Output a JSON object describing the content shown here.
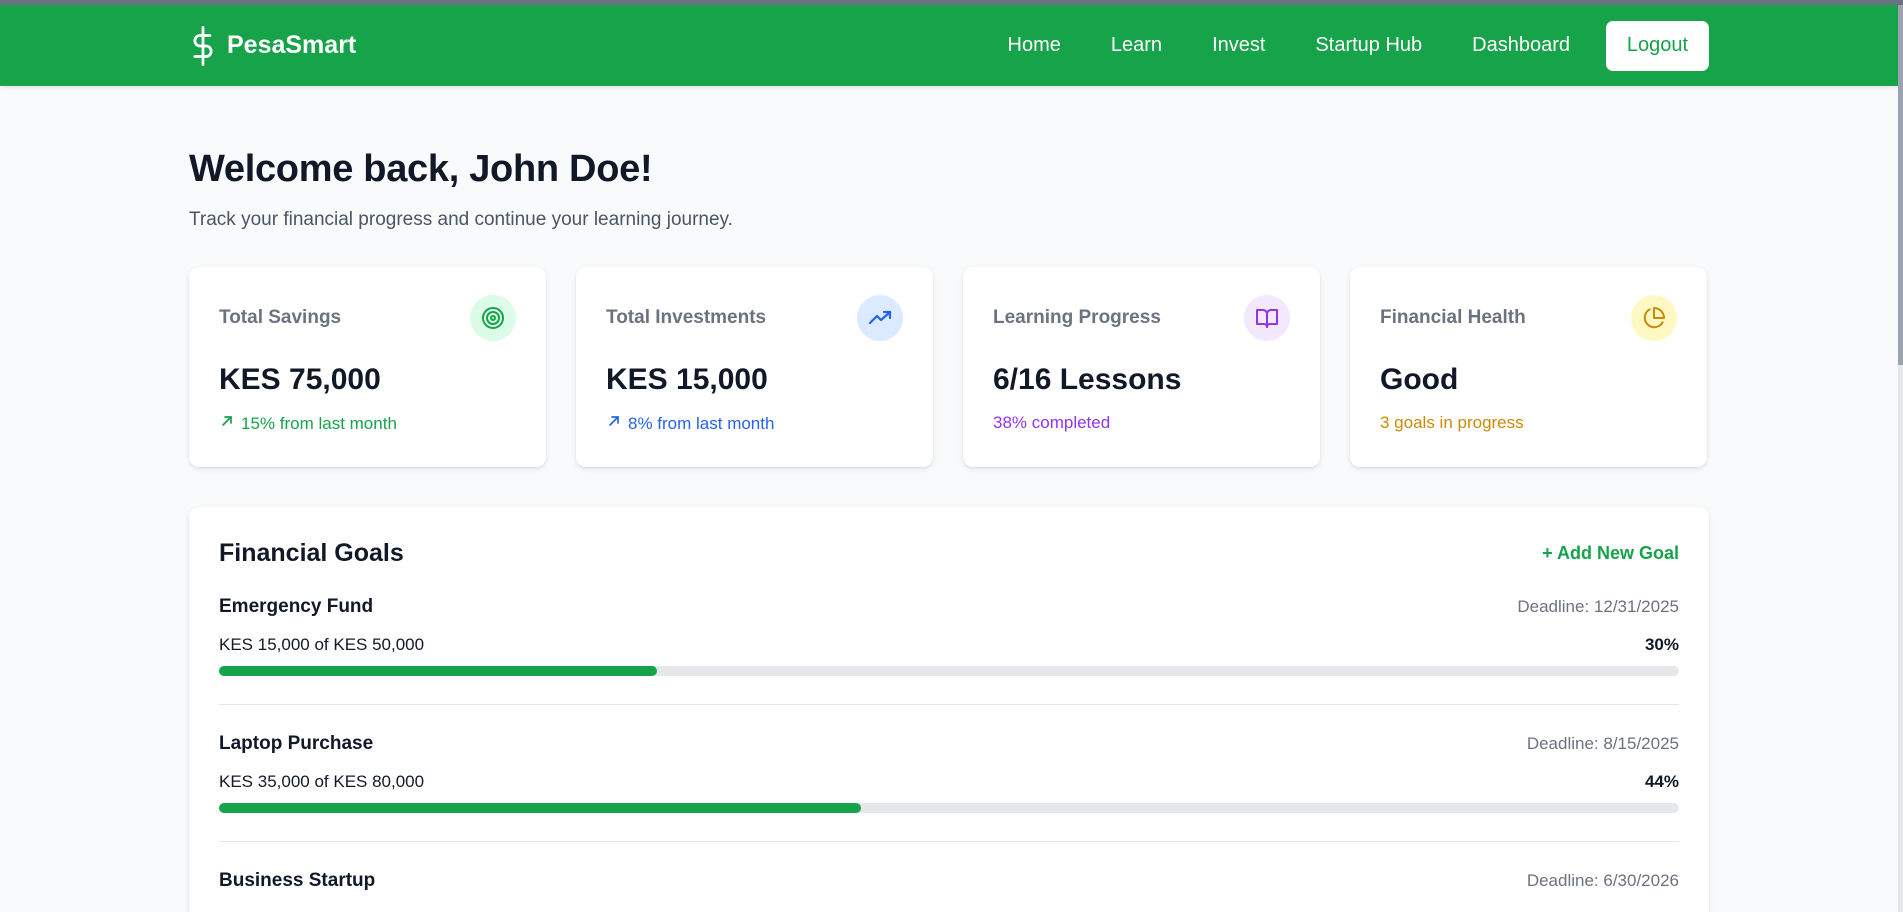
{
  "nav": {
    "brand": "PesaSmart",
    "links": [
      "Home",
      "Learn",
      "Invest",
      "Startup Hub",
      "Dashboard"
    ],
    "logout": "Logout"
  },
  "welcome": {
    "title": "Welcome back, John Doe!",
    "subtitle": "Track your financial progress and continue your learning journey."
  },
  "cards": [
    {
      "label": "Total Savings",
      "value": "KES 75,000",
      "note": "15% from last month",
      "icon": "target-icon",
      "color": "#16a34a",
      "bg": "#dcfce7",
      "trend": true
    },
    {
      "label": "Total Investments",
      "value": "KES 15,000",
      "note": "8% from last month",
      "icon": "trending-up-icon",
      "color": "#2563eb",
      "bg": "#dbeafe",
      "trend": true
    },
    {
      "label": "Learning Progress",
      "value": "6/16 Lessons",
      "note": "38% completed",
      "icon": "book-open-icon",
      "color": "#9333ea",
      "bg": "#f3e8ff",
      "trend": false
    },
    {
      "label": "Financial Health",
      "value": "Good",
      "note": "3 goals in progress",
      "icon": "pie-chart-icon",
      "color": "#ca8a04",
      "bg": "#fef9c3",
      "trend": false
    }
  ],
  "goals": {
    "title": "Financial Goals",
    "add_label": "+ Add New Goal",
    "items": [
      {
        "name": "Emergency Fund",
        "deadline": "Deadline: 12/31/2025",
        "amount": "KES 15,000 of KES 50,000",
        "percent": "30%",
        "progress": 0.3
      },
      {
        "name": "Laptop Purchase",
        "deadline": "Deadline: 8/15/2025",
        "amount": "KES 35,000 of KES 80,000",
        "percent": "44%",
        "progress": 0.44
      },
      {
        "name": "Business Startup",
        "deadline": "Deadline: 6/30/2026",
        "amount": "",
        "percent": "",
        "progress": null
      }
    ]
  }
}
